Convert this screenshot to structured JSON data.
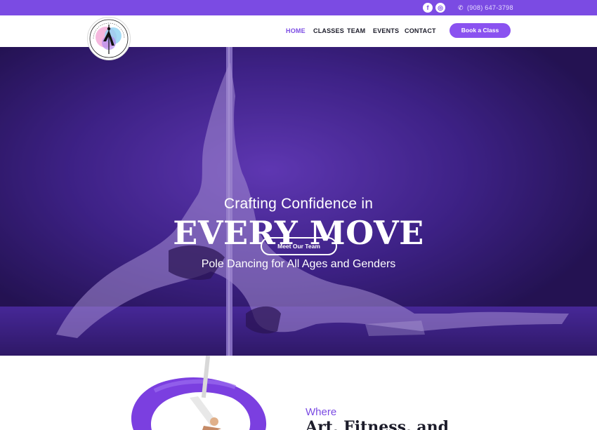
{
  "topbar": {
    "phone": "(908) 647-3798",
    "facebook_glyph": "f",
    "instagram_glyph": "◎"
  },
  "brand": {
    "logo_text": "AERIAL ACADEMY"
  },
  "nav": {
    "items": [
      {
        "label": "HOME",
        "active": true
      },
      {
        "label": "CLASSES",
        "active": false
      },
      {
        "label": "TEAM",
        "active": false
      },
      {
        "label": "EVENTS",
        "active": false
      },
      {
        "label": "CONTACT",
        "active": false
      }
    ],
    "cta": "Book a Class"
  },
  "hero": {
    "subtitle": "Crafting Confidence in",
    "title": "EVERY MOVE",
    "tagline": "Pole Dancing for All Ages and Genders",
    "button": "Meet Our Team"
  },
  "intro": {
    "eyebrow": "Where",
    "heading": "Art, Fitness, and"
  },
  "colors": {
    "accent": "#7b4be3",
    "button": "#8a52f0",
    "hero_overlay": "#3a1f7a"
  },
  "icons": {
    "facebook": "facebook-icon",
    "instagram": "instagram-icon",
    "phone": "phone-icon"
  }
}
